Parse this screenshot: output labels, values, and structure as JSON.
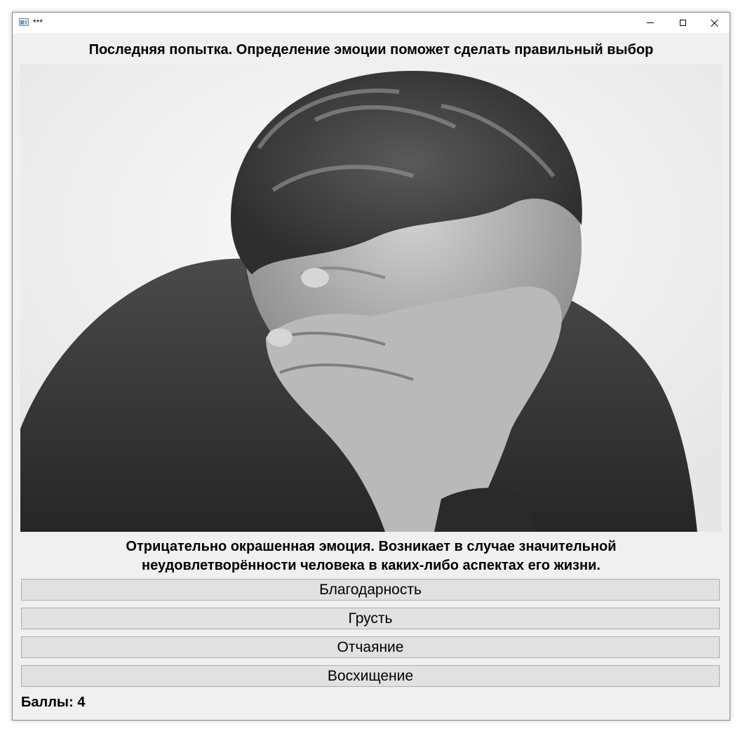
{
  "window": {
    "title": "***",
    "icons": [
      "app-icon",
      "minimize-icon",
      "maximize-icon",
      "close-icon"
    ]
  },
  "heading": "Последняя попытка. Определение эмоции поможет сделать правильный выбор",
  "photo": {
    "subject": "grayscale photo of a man covering his face with his hand"
  },
  "description": {
    "line1": "Отрицательно окрашенная эмоция. Возникает в случае значительной",
    "line2": "неудовлетворённости человека в каких-либо аспектах его жизни."
  },
  "answers": [
    {
      "label": "Благодарность"
    },
    {
      "label": "Грусть"
    },
    {
      "label": "Отчаяние"
    },
    {
      "label": "Восхищение"
    }
  ],
  "score": {
    "text": "Баллы: 4"
  },
  "colors": {
    "window_bg": "#f0f0f0",
    "button_bg": "#e1e1e1",
    "button_border": "#adadad"
  }
}
